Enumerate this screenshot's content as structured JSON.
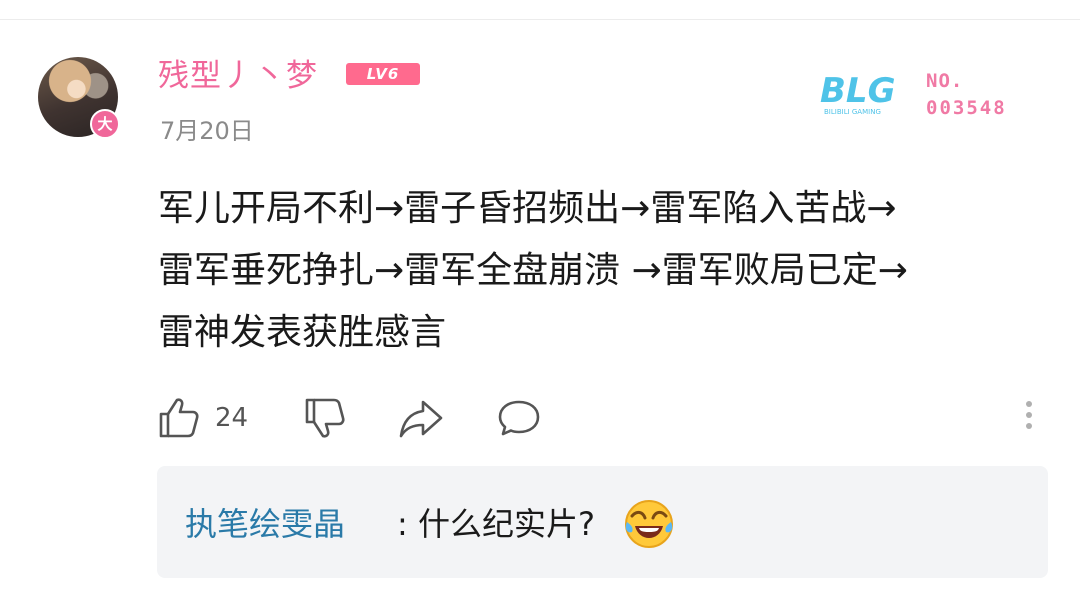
{
  "comment": {
    "username": "残型丿丶梦",
    "level_badge": "LV6",
    "avatar_badge": "大",
    "date": "7月20日",
    "fan_badge": {
      "logo_text": "BLG",
      "logo_subtext": "BILIBILI GAMING",
      "number_label": "NO.",
      "number_value": "003548"
    },
    "text_lines": [
      "军儿开局不利→雷子昏招频出→雷军陷入苦战→",
      "雷军垂死挣扎→雷军全盘崩溃 →雷军败局已定→",
      "雷神发表获胜感言"
    ],
    "like_count": "24"
  },
  "icons": {
    "like": "thumbs-up-icon",
    "dislike": "thumbs-down-icon",
    "share": "share-icon",
    "reply": "comment-bubble-icon",
    "more": "more-vertical-icon"
  },
  "reply": {
    "username": "执笔绘雯晶",
    "text": ": 什么纪实片?",
    "emoji": "laughing-tears-emoji"
  },
  "colors": {
    "username": "#f0679a",
    "level_badge": "#ff6a8e",
    "reply_username": "#2a7aa8",
    "logo_blue": "#4fc3e8",
    "reply_bg": "#f3f4f6"
  }
}
